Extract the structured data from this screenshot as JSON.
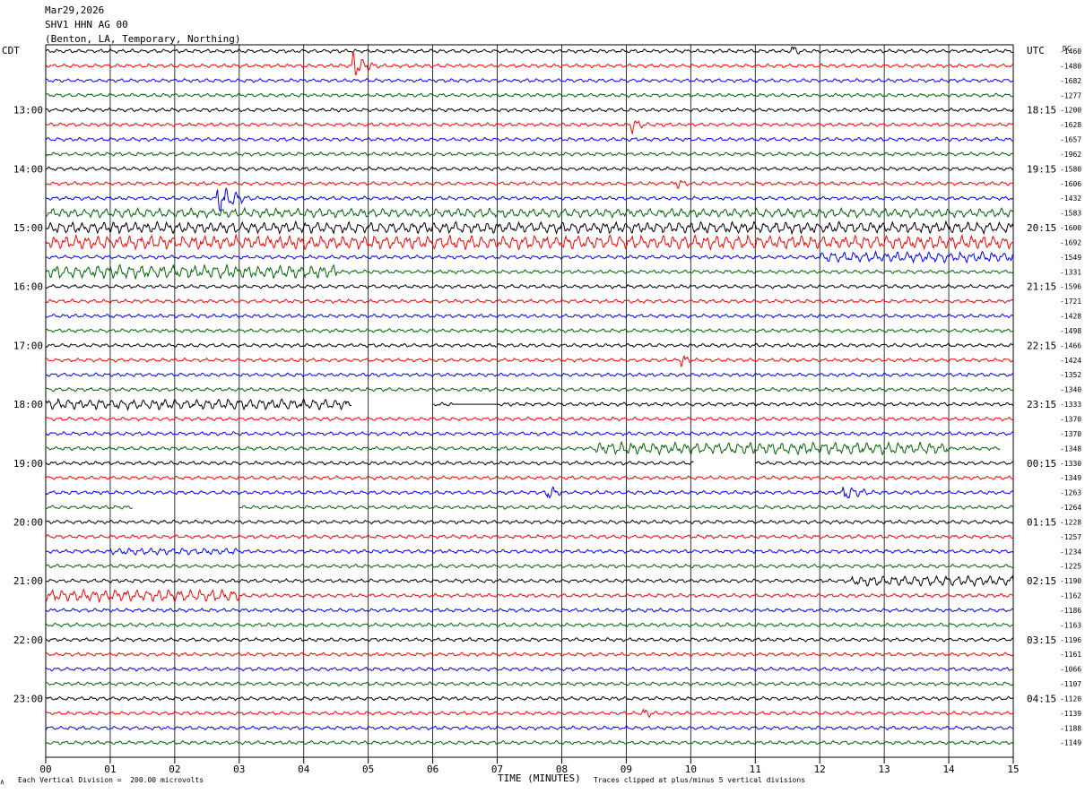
{
  "header": {
    "date": "Mar29,2026",
    "station": "SHV1 HHN AG 00",
    "location": "(Benton, LA, Temporary, Northing)"
  },
  "labels": {
    "left_tz": "CDT",
    "right_tz": "UTC",
    "dc": "DC",
    "corner": "∧"
  },
  "footer": {
    "scale_note": "Each Vertical Division =  200.00 microvolts",
    "xlabel": "TIME (MINUTES)",
    "clip_note": "Traces clipped at plus/minus 5 vertical divisions"
  },
  "chart_data": {
    "type": "line",
    "title": "SHV1 HHN AG 00 helicorder",
    "xlabel": "TIME (MINUTES)",
    "xlim": [
      0,
      15
    ],
    "x_ticks": [
      "00",
      "01",
      "02",
      "03",
      "04",
      "05",
      "06",
      "07",
      "08",
      "09",
      "10",
      "11",
      "12",
      "13",
      "14",
      "15"
    ],
    "rows_per_hour": 4,
    "row_minutes": 15,
    "left_hour_labels": [
      "13:00",
      "14:00",
      "15:00",
      "16:00",
      "17:00",
      "18:00",
      "19:00",
      "20:00",
      "21:00",
      "22:00",
      "23:00"
    ],
    "right_hour_labels": [
      "18:15",
      "19:15",
      "20:15",
      "21:15",
      "22:15",
      "23:15",
      "00:15",
      "01:15",
      "02:15",
      "03:15",
      "04:15"
    ],
    "trace_colors": [
      "#000000",
      "#ff0000",
      "#0000ff",
      "#006600"
    ],
    "dc_offsets": [
      "-1460",
      "-1480",
      "-1682",
      "-1277",
      "-1200",
      "-1628",
      "-1657",
      "-1962",
      "-1580",
      "-1606",
      "-1432",
      "-1583",
      "-1600",
      "-1692",
      "-1549",
      "-1331",
      "-1596",
      "-1721",
      "-1428",
      "-1498",
      "-1466",
      "-1424",
      "-1352",
      "-1340",
      "-1333",
      "-1370",
      "-1370",
      "-1348",
      "-1330",
      "-1349",
      "-1263",
      "-1264",
      "-1228",
      "-1257",
      "-1234",
      "-1225",
      "-1190",
      "-1162",
      "-1186",
      "-1163",
      "-1196",
      "-1161",
      "-1066",
      "-1107",
      "-1120",
      "-1139",
      "-1188",
      "-1149"
    ],
    "events": [
      {
        "row": 1,
        "minute": 4.8,
        "amp": 3.0,
        "dur": 0.6
      },
      {
        "row": 0,
        "minute": 11.6,
        "amp": 1.5,
        "dur": 0.3
      },
      {
        "row": 5,
        "minute": 9.1,
        "amp": 1.8,
        "dur": 0.5
      },
      {
        "row": 10,
        "minute": 2.7,
        "amp": 3.5,
        "dur": 0.8
      },
      {
        "row": 9,
        "minute": 9.8,
        "amp": 1.2,
        "dur": 0.5
      },
      {
        "row": 30,
        "minute": 7.8,
        "amp": 1.6,
        "dur": 0.6
      },
      {
        "row": 30,
        "minute": 12.4,
        "amp": 1.8,
        "dur": 1.0
      },
      {
        "row": 21,
        "minute": 9.9,
        "amp": 1.5,
        "dur": 0.3
      },
      {
        "row": 45,
        "minute": 9.3,
        "amp": 1.2,
        "dur": 0.5
      }
    ],
    "noisy_segments": [
      {
        "row": 11,
        "start": 0,
        "end": 15,
        "amp": 1.2
      },
      {
        "row": 12,
        "start": 0,
        "end": 15,
        "amp": 1.5
      },
      {
        "row": 13,
        "start": 0,
        "end": 15,
        "amp": 1.8
      },
      {
        "row": 14,
        "start": 12,
        "end": 15,
        "amp": 1.4
      },
      {
        "row": 15,
        "start": 0,
        "end": 4.5,
        "amp": 1.8
      },
      {
        "row": 24,
        "start": 0,
        "end": 4.7,
        "amp": 1.4
      },
      {
        "row": 27,
        "start": 8.5,
        "end": 14,
        "amp": 1.6
      },
      {
        "row": 36,
        "start": 12.5,
        "end": 15,
        "amp": 1.4
      },
      {
        "row": 37,
        "start": 0,
        "end": 3,
        "amp": 1.6
      },
      {
        "row": 34,
        "start": 1,
        "end": 3,
        "amp": 0.9
      }
    ],
    "gaps": [
      {
        "row": 24,
        "start": 4.75,
        "end": 6.0
      },
      {
        "row": 24,
        "start": 6.3,
        "end": 7.0,
        "flat": true
      },
      {
        "row": 28,
        "start": 10.05,
        "end": 11.0
      },
      {
        "row": 31,
        "start": 1.35,
        "end": 3.0
      },
      {
        "row": 27,
        "start": 14.8,
        "end": 15.0
      }
    ]
  }
}
